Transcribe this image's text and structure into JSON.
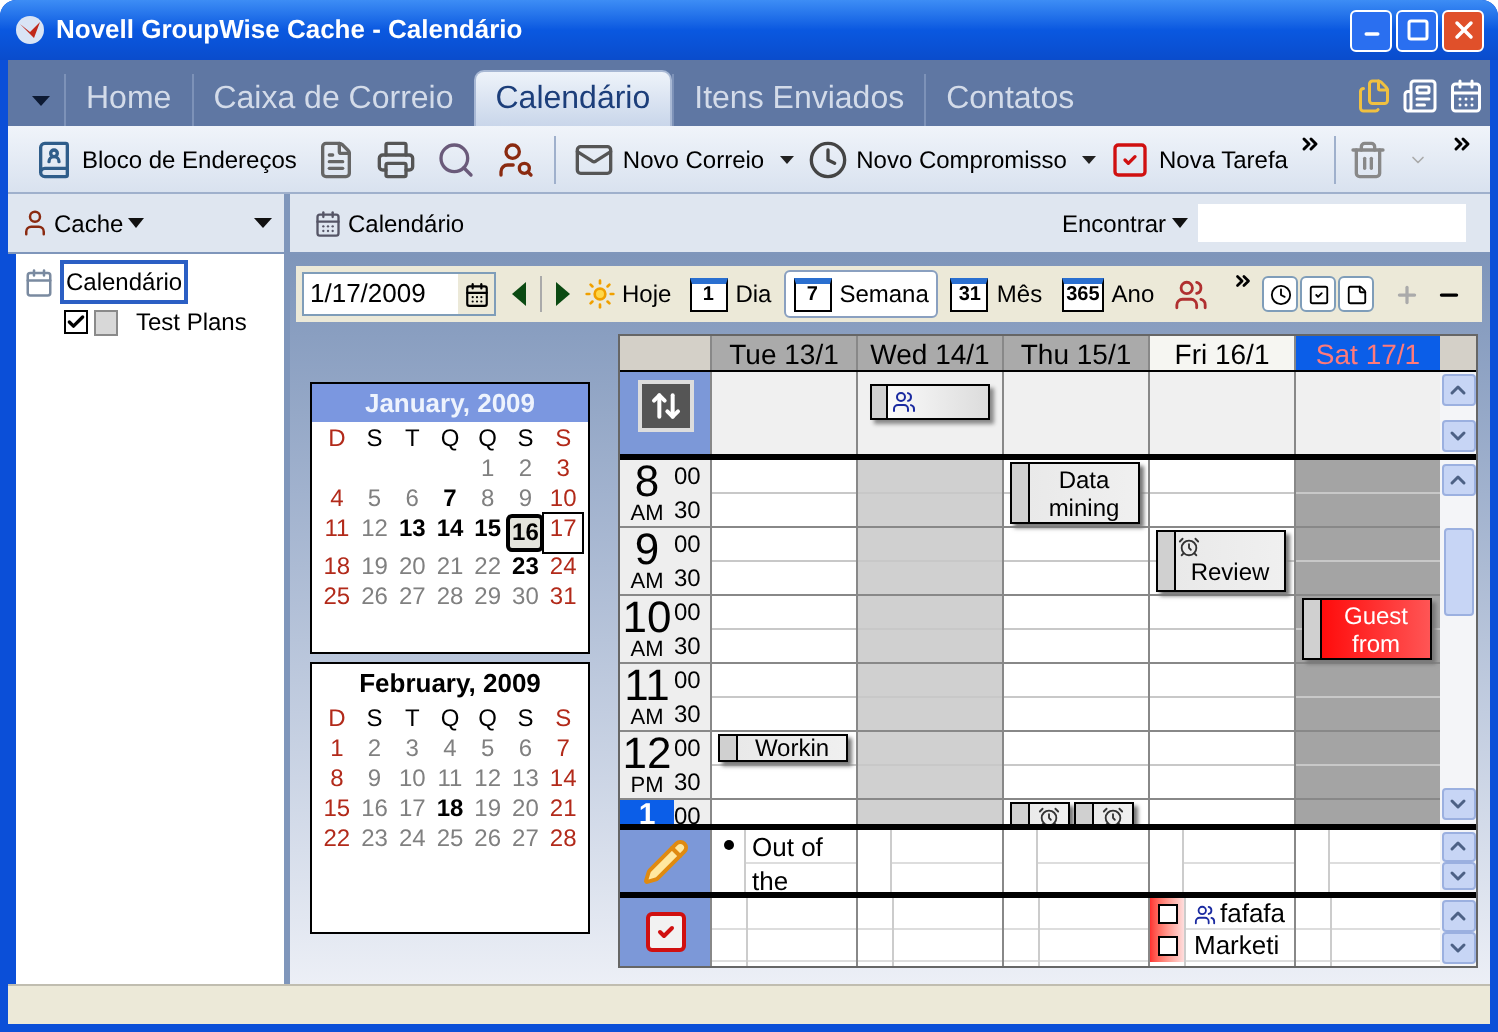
{
  "window": {
    "title": "Novell GroupWise Cache - Calendário"
  },
  "tabs": [
    {
      "label": "Home",
      "selected": false
    },
    {
      "label": "Caixa de Correio",
      "selected": false
    },
    {
      "label": "Calendário",
      "selected": true
    },
    {
      "label": "Itens Enviados",
      "selected": false
    },
    {
      "label": "Contatos",
      "selected": false
    }
  ],
  "toolbar": [
    {
      "kind": "address_book",
      "label": "Bloco de Endereços"
    },
    {
      "kind": "properties"
    },
    {
      "kind": "print"
    },
    {
      "kind": "find"
    },
    {
      "kind": "proxy"
    },
    {
      "kind": "mail",
      "label": "Novo Correio",
      "dropdown": true
    },
    {
      "kind": "appointment",
      "label": "Novo Compromisso",
      "dropdown": true
    },
    {
      "kind": "task",
      "label": "Nova Tarefa",
      "dropdown": false
    }
  ],
  "folder_panel": {
    "account": "Cache",
    "tree": [
      {
        "label": "Calendário",
        "selected": true,
        "children": [
          {
            "label": "Test Plans",
            "checked": true,
            "selected": false
          }
        ]
      }
    ]
  },
  "header": {
    "title": "Calendário",
    "find_label": "Encontrar"
  },
  "view_bar": {
    "date": "1/17/2009",
    "today": "Hoje",
    "views": [
      {
        "label": "Dia",
        "icon_text": "1",
        "selected": false
      },
      {
        "label": "Semana",
        "icon_text": "7",
        "selected": true
      },
      {
        "label": "Mês",
        "icon_text": "31",
        "selected": false
      },
      {
        "label": "Ano",
        "icon_text": "365",
        "selected": false
      }
    ]
  },
  "mini_calendars": [
    {
      "title": "January, 2009",
      "current": true,
      "weekdays": [
        "D",
        "S",
        "T",
        "Q",
        "Q",
        "S",
        "S"
      ],
      "weeks": [
        [
          {
            "d": "1",
            "busy": false,
            "today": false,
            "selected": false
          },
          {
            "d": "2",
            "busy": false,
            "today": false,
            "selected": false
          },
          {
            "d": "3",
            "busy": false,
            "today": false,
            "selected": false
          }
        ],
        [
          {
            "d": "4",
            "busy": false,
            "today": false,
            "selected": false
          },
          {
            "d": "5",
            "busy": false,
            "today": false,
            "selected": false
          },
          {
            "d": "6",
            "busy": false,
            "today": false,
            "selected": false
          },
          {
            "d": "7",
            "busy": true,
            "today": false,
            "selected": false
          },
          {
            "d": "8",
            "busy": false,
            "today": false,
            "selected": false
          },
          {
            "d": "9",
            "busy": false,
            "today": false,
            "selected": false
          },
          {
            "d": "10",
            "busy": false,
            "today": false,
            "selected": false
          }
        ],
        [
          {
            "d": "11",
            "busy": false,
            "today": false,
            "selected": false
          },
          {
            "d": "12",
            "busy": false,
            "today": false,
            "selected": false
          },
          {
            "d": "13",
            "busy": true,
            "today": false,
            "selected": false
          },
          {
            "d": "14",
            "busy": true,
            "today": false,
            "selected": false
          },
          {
            "d": "15",
            "busy": true,
            "today": false,
            "selected": false
          },
          {
            "d": "16",
            "busy": true,
            "today": true,
            "selected": false
          },
          {
            "d": "17",
            "busy": false,
            "today": false,
            "selected": true
          }
        ],
        [
          {
            "d": "18",
            "busy": false,
            "today": false,
            "selected": false
          },
          {
            "d": "19",
            "busy": false,
            "today": false,
            "selected": false
          },
          {
            "d": "20",
            "busy": false,
            "today": false,
            "selected": false
          },
          {
            "d": "21",
            "busy": false,
            "today": false,
            "selected": false
          },
          {
            "d": "22",
            "busy": false,
            "today": false,
            "selected": false
          },
          {
            "d": "23",
            "busy": true,
            "today": false,
            "selected": false
          },
          {
            "d": "24",
            "busy": false,
            "today": false,
            "selected": false
          }
        ],
        [
          {
            "d": "25",
            "busy": false,
            "today": false,
            "selected": false
          },
          {
            "d": "26",
            "busy": false,
            "today": false,
            "selected": false
          },
          {
            "d": "27",
            "busy": false,
            "today": false,
            "selected": false
          },
          {
            "d": "28",
            "busy": false,
            "today": false,
            "selected": false
          },
          {
            "d": "29",
            "busy": false,
            "today": false,
            "selected": false
          },
          {
            "d": "30",
            "busy": false,
            "today": false,
            "selected": false
          },
          {
            "d": "31",
            "busy": false,
            "today": false,
            "selected": false
          }
        ]
      ]
    },
    {
      "title": "February, 2009",
      "current": false,
      "weekdays": [
        "D",
        "S",
        "T",
        "Q",
        "Q",
        "S",
        "S"
      ],
      "weeks": [
        [
          {
            "d": "1",
            "busy": false,
            "today": false,
            "selected": false
          },
          {
            "d": "2",
            "busy": false,
            "today": false,
            "selected": false
          },
          {
            "d": "3",
            "busy": false,
            "today": false,
            "selected": false
          },
          {
            "d": "4",
            "busy": false,
            "today": false,
            "selected": false
          },
          {
            "d": "5",
            "busy": false,
            "today": false,
            "selected": false
          },
          {
            "d": "6",
            "busy": false,
            "today": false,
            "selected": false
          },
          {
            "d": "7",
            "busy": false,
            "today": false,
            "selected": false
          }
        ],
        [
          {
            "d": "8",
            "busy": false,
            "today": false,
            "selected": false
          },
          {
            "d": "9",
            "busy": false,
            "today": false,
            "selected": false
          },
          {
            "d": "10",
            "busy": false,
            "today": false,
            "selected": false
          },
          {
            "d": "11",
            "busy": false,
            "today": false,
            "selected": false
          },
          {
            "d": "12",
            "busy": false,
            "today": false,
            "selected": false
          },
          {
            "d": "13",
            "busy": false,
            "today": false,
            "selected": false
          },
          {
            "d": "14",
            "busy": false,
            "today": false,
            "selected": false
          }
        ],
        [
          {
            "d": "15",
            "busy": false,
            "today": false,
            "selected": false
          },
          {
            "d": "16",
            "busy": false,
            "today": false,
            "selected": false
          },
          {
            "d": "17",
            "busy": false,
            "today": false,
            "selected": false
          },
          {
            "d": "18",
            "busy": true,
            "today": false,
            "selected": false
          },
          {
            "d": "19",
            "busy": false,
            "today": false,
            "selected": false
          },
          {
            "d": "20",
            "busy": false,
            "today": false,
            "selected": false
          },
          {
            "d": "21",
            "busy": false,
            "today": false,
            "selected": false
          }
        ],
        [
          {
            "d": "22",
            "busy": false,
            "today": false,
            "selected": false
          },
          {
            "d": "23",
            "busy": false,
            "today": false,
            "selected": false
          },
          {
            "d": "24",
            "busy": false,
            "today": false,
            "selected": false
          },
          {
            "d": "25",
            "busy": false,
            "today": false,
            "selected": false
          },
          {
            "d": "26",
            "busy": false,
            "today": false,
            "selected": false
          },
          {
            "d": "27",
            "busy": false,
            "today": false,
            "selected": false
          },
          {
            "d": "28",
            "busy": false,
            "today": false,
            "selected": false
          }
        ]
      ]
    }
  ],
  "week": {
    "hours": [
      {
        "hour": "8",
        "period": "AM",
        "minutes": [
          "00",
          "30"
        ],
        "current": false
      },
      {
        "hour": "9",
        "period": "AM",
        "minutes": [
          "00",
          "30"
        ],
        "current": false
      },
      {
        "hour": "10",
        "period": "AM",
        "minutes": [
          "00",
          "30"
        ],
        "current": false
      },
      {
        "hour": "11",
        "period": "AM",
        "minutes": [
          "00",
          "30"
        ],
        "current": false
      },
      {
        "hour": "12",
        "period": "PM",
        "minutes": [
          "00",
          "30"
        ],
        "current": false
      },
      {
        "hour": "1",
        "minutes": [
          "00"
        ],
        "current": true
      }
    ],
    "days": [
      {
        "label": "Tue 13/1",
        "kind": "workday",
        "today": false,
        "selected": false,
        "timeline": [
          {
            "kind": "free"
          },
          {
            "kind": "free"
          },
          {
            "kind": "free"
          },
          {
            "kind": "free"
          },
          {
            "kind": "free"
          },
          {
            "kind": "free"
          },
          {
            "kind": "free"
          },
          {
            "kind": "free"
          },
          {
            "kind": "half_hour",
            "events": [
              {
                "title": "Workin",
                "alarm": false,
                "color": "#e8e8e8"
              }
            ]
          }
        ],
        "notes": [
          "Out of the"
        ]
      },
      {
        "label": "Wed 14/1",
        "kind": "off",
        "today": false,
        "selected": false,
        "all_day": [
          {
            "kind": "shared"
          }
        ]
      },
      {
        "label": "Thu 15/1",
        "kind": "workday",
        "today": false,
        "selected": false,
        "timeline": [
          {
            "kind": "hour",
            "events": [
              {
                "title": "Data mining",
                "alarm": false,
                "color": "#e8e8e8"
              }
            ]
          },
          {
            "kind": "free"
          },
          {
            "kind": "free"
          },
          {
            "kind": "free"
          },
          {
            "kind": "free"
          },
          {
            "kind": "free"
          },
          {
            "kind": "free"
          },
          {
            "kind": "free"
          },
          {
            "kind": "free"
          },
          {
            "kind": "half_hour",
            "events": [
              {
                "alarm": true,
                "color": "#e8e8e8"
              },
              {
                "alarm": true,
                "color": "#e8e8e8"
              }
            ]
          }
        ]
      },
      {
        "label": "Fri 16/1",
        "kind": "workday",
        "today": true,
        "selected": false,
        "timeline": [
          {
            "kind": "free"
          },
          {
            "kind": "free"
          },
          {
            "kind": "hour",
            "events": [
              {
                "title": "Review",
                "alarm": true,
                "color": "#e8e8e8"
              }
            ]
          }
        ],
        "tasks": [
          {
            "title": "fafafa",
            "kind": "shared",
            "checked": false
          },
          {
            "title": "Marketi",
            "kind": "plain",
            "checked": false
          }
        ]
      },
      {
        "label": "Sat 17/1",
        "kind": "weekend",
        "today": false,
        "selected": true,
        "timeline": [
          {
            "kind": "free"
          },
          {
            "kind": "free"
          },
          {
            "kind": "free"
          },
          {
            "kind": "free"
          },
          {
            "kind": "hour",
            "events": [
              {
                "title": "Guest from",
                "alarm": false,
                "color": "#ff0000"
              }
            ]
          }
        ]
      }
    ]
  }
}
